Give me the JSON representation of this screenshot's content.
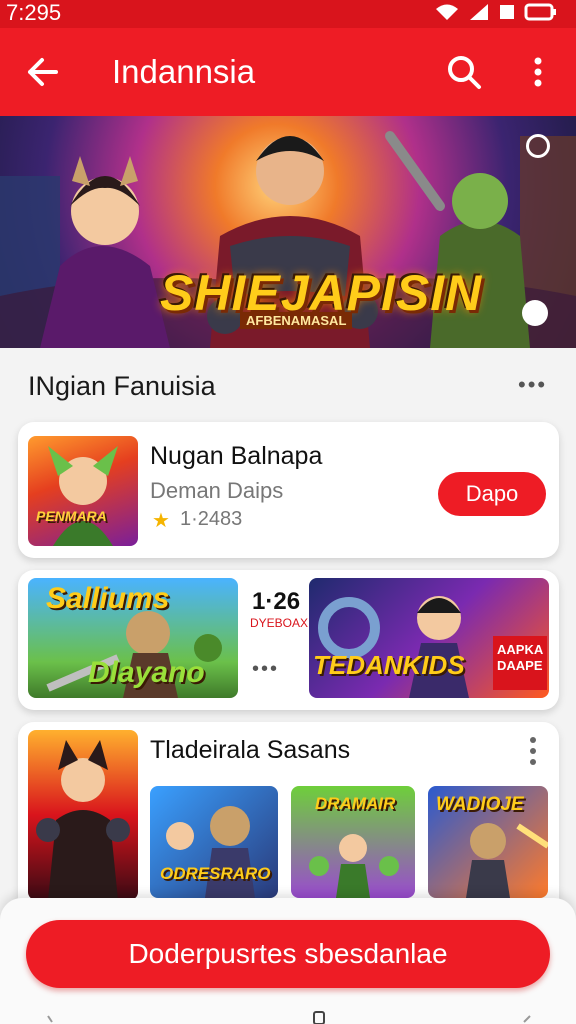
{
  "status_bar": {
    "time": "7:295"
  },
  "app_bar": {
    "title": "Indannsia"
  },
  "banner": {
    "title": "SHIEJAPISIN",
    "subtitle": "AFBENAMASAL"
  },
  "section": {
    "heading": "INgian Fanuisia"
  },
  "featured_app": {
    "name": "Nugan Balnapa",
    "developer": "Deman Daips",
    "rating": "1·2483",
    "install_label": "Dapo",
    "thumb_text": "PENMARA"
  },
  "promo_row": {
    "left_thumb_title": "Salliums",
    "left_thumb_sub": "Dlayano",
    "count": "1·26",
    "code": "DYEBOAX",
    "right_thumb_title": "TEDANKIDS",
    "right_badge": "AAPKA DAAPE"
  },
  "collection": {
    "title": "Tladeirala Sasans",
    "thumbs": [
      "ODRESRARO",
      "DRAMAIR",
      "WADIOJE"
    ]
  },
  "cta": {
    "label": "Doderpusrtes sbesdanlae"
  },
  "colors": {
    "accent": "#ee1c25",
    "status": "#d9141c",
    "star": "#f5b400"
  }
}
